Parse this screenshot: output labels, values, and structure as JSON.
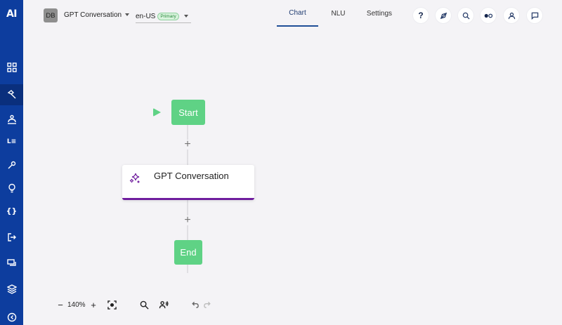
{
  "sidebar": {
    "logo": "AI",
    "items": [
      {
        "icon": "dashboard-grid-icon"
      },
      {
        "icon": "build-hammer-icon",
        "active": true
      },
      {
        "icon": "users-hierarchy-icon"
      },
      {
        "icon": "list-text-icon",
        "text": "L≡"
      },
      {
        "icon": "tools-wrench-icon"
      },
      {
        "icon": "lightbulb-icon"
      },
      {
        "icon": "variables-braces-icon",
        "text": "{}"
      },
      {
        "icon": "logout-arrow-icon"
      },
      {
        "icon": "conversations-chat-icon"
      },
      {
        "icon": "layers-stack-icon"
      },
      {
        "icon": "collapse-circle-icon"
      }
    ]
  },
  "header": {
    "avatar_initials": "DB",
    "project_name": "GPT Conversation",
    "locale": "en-US",
    "locale_badge": "Primary",
    "tabs": [
      {
        "label": "Chart",
        "active": true
      },
      {
        "label": "NLU"
      },
      {
        "label": "Settings"
      }
    ],
    "help_label": "?",
    "actions": [
      "help-icon",
      "compass-icon",
      "search-icon",
      "toggle-dots-icon",
      "user-profile-icon",
      "chat-bubble-icon"
    ]
  },
  "flow": {
    "start_label": "Start",
    "gpt_node_title": "GPT Conversation",
    "end_label": "End"
  },
  "toolbar": {
    "zoom_out": "−",
    "zoom_level": "140%",
    "zoom_in": "+"
  },
  "colors": {
    "sidebar_bg": "#0d3d9e",
    "node_green": "#5fd285",
    "gpt_accent": "#6f1d9e",
    "canvas_bg": "#f4f3f6"
  }
}
